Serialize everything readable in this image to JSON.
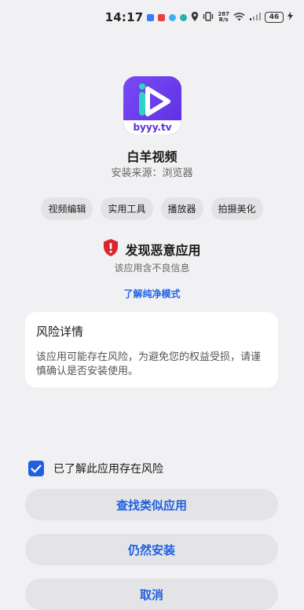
{
  "status_bar": {
    "time": "14:17",
    "net_speed_top": "287",
    "net_speed_bottom": "B/s",
    "battery": "46",
    "notif_colors": [
      "#3b7bf6",
      "#e8423f",
      "#3db0f5",
      "#2ab0a6"
    ],
    "icons": [
      "location-icon",
      "vibrate-icon",
      "wifi-icon",
      "signal-icon",
      "charging-icon"
    ]
  },
  "app": {
    "name": "白羊视频",
    "source": "安装来源：浏览器",
    "logo_text": "byyy.tv",
    "logo_color": "#6c3df0",
    "logo_accent": "#2ed3c5",
    "tags": [
      "视频编辑",
      "实用工具",
      "播放器",
      "拍摄美化"
    ]
  },
  "warning": {
    "title": "发现恶意应用",
    "subtitle": "该应用含不良信息",
    "link": "了解纯净模式",
    "shield_color": "#d8262c"
  },
  "risk_card": {
    "title": "风险详情",
    "text": "该应用可能存在风险，为避免您的权益受损，请谨慎确认是否安装使用。"
  },
  "confirm": {
    "label": "已了解此应用存在风险",
    "checked": true
  },
  "buttons": {
    "similar": "查找类似应用",
    "install": "仍然安装",
    "cancel": "取消"
  },
  "colors": {
    "accent": "#1f5fe0",
    "background": "#f1f1f3"
  }
}
